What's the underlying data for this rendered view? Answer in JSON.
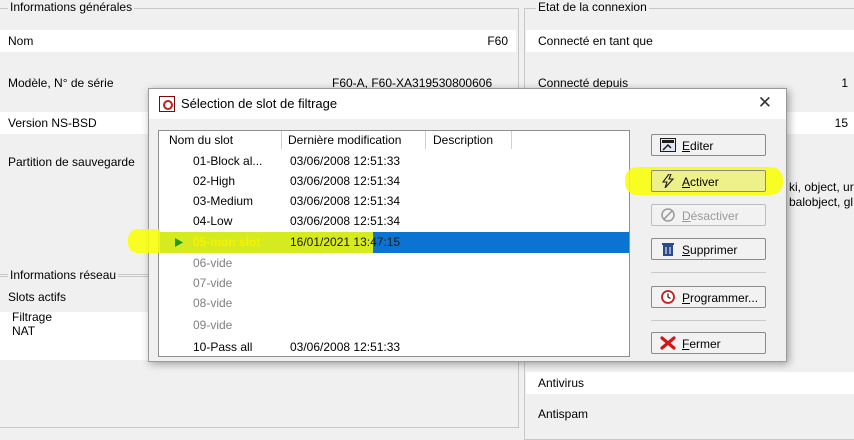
{
  "background": {
    "general_title": "Informations générales",
    "general": {
      "nom_label": "Nom",
      "nom_value": "F60",
      "modele_label": "Modèle, N° de série",
      "modele_value": "F60-A, F60-XA319530800606",
      "version_label": "Version NS-BSD",
      "partition_label": "Partition de sauvegarde"
    },
    "network_title": "Informations réseau",
    "network": {
      "slots_label": "Slots actifs",
      "filtrage_label": "Filtrage",
      "nat_label": "NAT"
    },
    "connection_title": "Etat de la connexion",
    "connection": {
      "connecte_label": "Connecté en tant que",
      "depuis_label": "Connecté depuis",
      "depuis_value_partial": "1",
      "version_value_partial": "15",
      "objects_line1": "ki, object, ur",
      "objects_line2": "balobject, gl",
      "antivirus_label": "Antivirus",
      "antispam_label": "Antispam"
    }
  },
  "dialog": {
    "title": "Sélection de slot de filtrage",
    "close_glyph": "✕",
    "columns": [
      "Nom du slot",
      "Dernière modification",
      "Description"
    ],
    "rows": [
      {
        "name": "01-Block al...",
        "modified": "03/06/2008 12:51:33",
        "description": "",
        "state": "normal"
      },
      {
        "name": "02-High",
        "modified": "03/06/2008 12:51:34",
        "description": "",
        "state": "normal"
      },
      {
        "name": "03-Medium",
        "modified": "03/06/2008 12:51:34",
        "description": "",
        "state": "normal"
      },
      {
        "name": "04-Low",
        "modified": "03/06/2008 12:51:34",
        "description": "",
        "state": "normal"
      },
      {
        "name": "05-mon slot",
        "modified": "16/01/2021 13:47:15",
        "description": "",
        "state": "selected"
      },
      {
        "name": "06-vide",
        "modified": "",
        "description": "",
        "state": "empty"
      },
      {
        "name": "07-vide",
        "modified": "",
        "description": "",
        "state": "empty"
      },
      {
        "name": "08-vide",
        "modified": "",
        "description": "",
        "state": "empty"
      },
      {
        "name": "09-vide",
        "modified": "",
        "description": "",
        "state": "empty"
      },
      {
        "name": "10-Pass all",
        "modified": "03/06/2008 12:51:33",
        "description": "",
        "state": "normal"
      }
    ],
    "buttons": {
      "edit": {
        "hotkey": "E",
        "rest": "diter"
      },
      "activate": {
        "hotkey": "A",
        "rest": "ctiver"
      },
      "deactivate": {
        "hotkey": "D",
        "rest": "ésactiver"
      },
      "delete": {
        "hotkey": "S",
        "rest": "upprimer"
      },
      "schedule": {
        "hotkey": "P",
        "rest": "rogrammer..."
      },
      "close": {
        "hotkey": "F",
        "rest": "ermer"
      }
    }
  },
  "colors": {
    "selection": "#0b73d1",
    "highlight": "#f9ff00",
    "active_slot_text": "#f6f200"
  }
}
